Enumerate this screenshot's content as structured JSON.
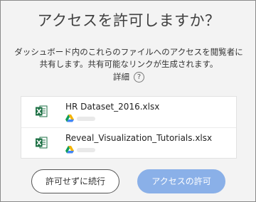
{
  "dialog": {
    "title": "アクセスを許可しますか？",
    "description_line1": "ダッシュボード内のこれらのファイルへのアクセスを閲覧者に",
    "description_line2": "共有します。共有可能なリンクが生成されます。",
    "details_label": "詳細",
    "help_icon": "?"
  },
  "files": [
    {
      "name": "HR Dataset_2016.xlsx",
      "icon": "excel-icon",
      "source_icon": "google-drive-icon"
    },
    {
      "name": "Reveal_Visualization_Tutorials.xlsx",
      "icon": "excel-icon",
      "source_icon": "google-drive-icon"
    }
  ],
  "buttons": {
    "continue_without_permission": "許可せずに続行",
    "allow_access": "アクセスの許可"
  },
  "colors": {
    "primary_button": "#8ab0e8",
    "excel_green": "#1e7145"
  }
}
